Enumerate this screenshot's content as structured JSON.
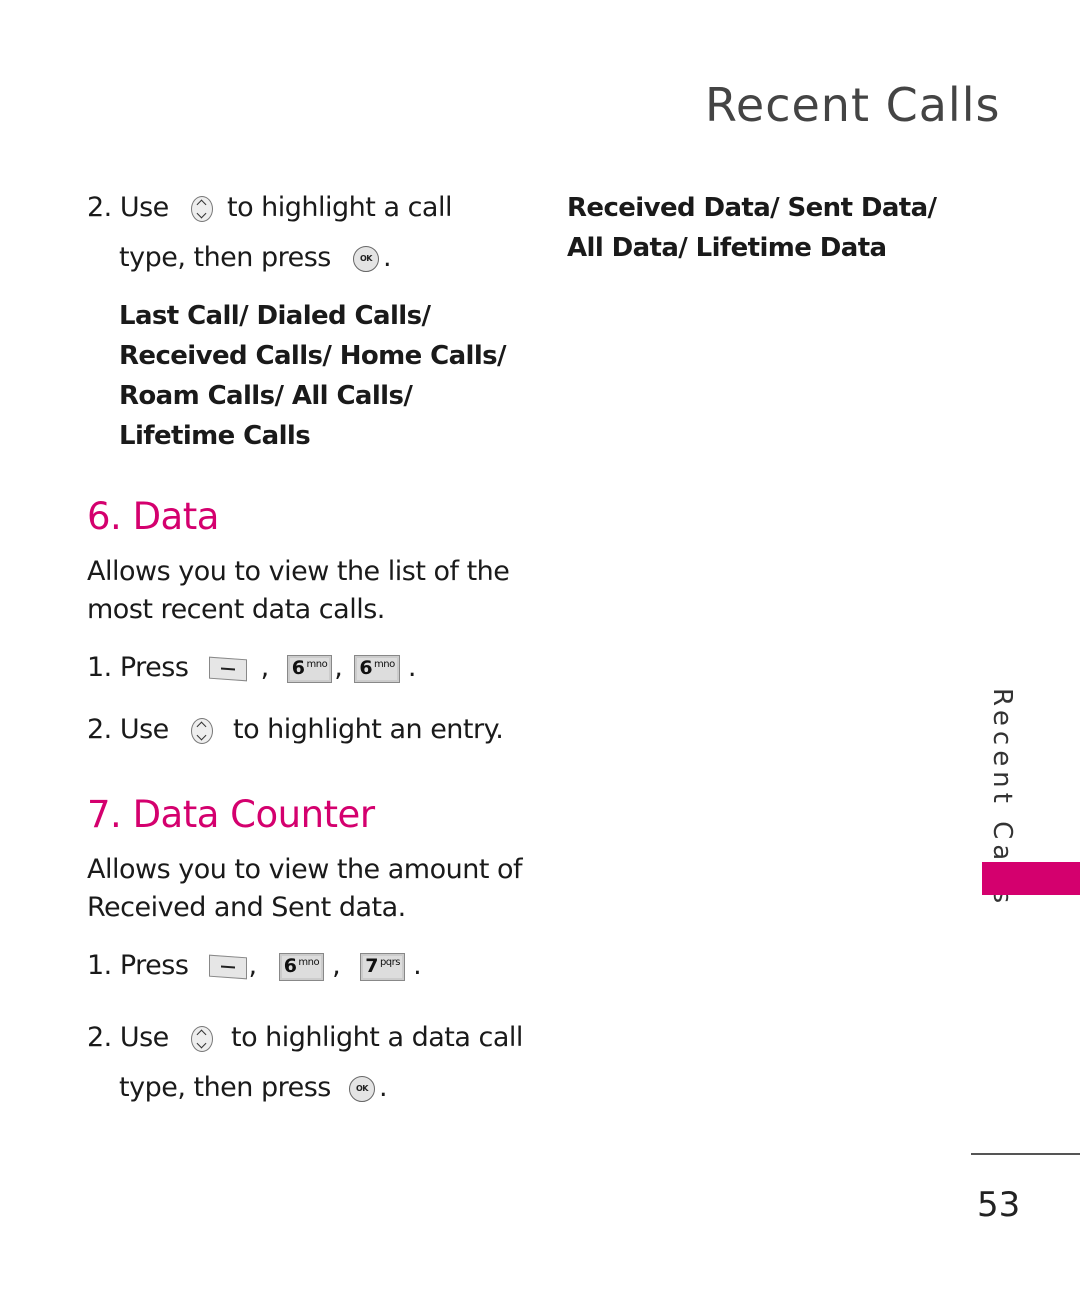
{
  "header": {
    "title": "Recent Calls"
  },
  "sidebar": {
    "tab_label": "Recent Calls",
    "accent_color": "#d4006e"
  },
  "page_number": "53",
  "left": {
    "step2a": {
      "prefix": "2. Use",
      "mid": "to highlight a call",
      "line2": "type, then press",
      "end": "."
    },
    "options": [
      "Last Call/ Dialed Calls/",
      "Received Calls/ Home Calls/",
      "Roam Calls/ All Calls/",
      "Lifetime Calls"
    ],
    "data_section": {
      "heading": "6. Data",
      "desc": [
        "Allows you to view the list of the",
        "most recent data calls."
      ],
      "step1_prefix": "1. Press",
      "keys": [
        {
          "num": "6",
          "letters": "mno"
        },
        {
          "num": "6",
          "letters": "mno"
        }
      ],
      "step2_prefix": "2. Use",
      "step2_text": "to highlight an entry."
    },
    "counter_section": {
      "heading": "7. Data Counter",
      "desc": [
        "Allows you to view the amount of",
        "Received and Sent data."
      ],
      "step1_prefix": "1. Press",
      "keys": [
        {
          "num": "6",
          "letters": "mno"
        },
        {
          "num": "7",
          "letters": "pqrs"
        }
      ],
      "step2_prefix": "2. Use",
      "step2_text": "to highlight a data call",
      "step2_line2": "type, then press",
      "end": "."
    }
  },
  "right": {
    "options": [
      "Received Data/ Sent Data/",
      "All Data/ Lifetime Data"
    ]
  },
  "icons": {
    "nav": "navigation-key-icon",
    "ok": "ok-key-icon",
    "ok_label": "OK",
    "soft": "left-soft-key-icon"
  },
  "punct": {
    "comma": ",",
    "period": "."
  }
}
